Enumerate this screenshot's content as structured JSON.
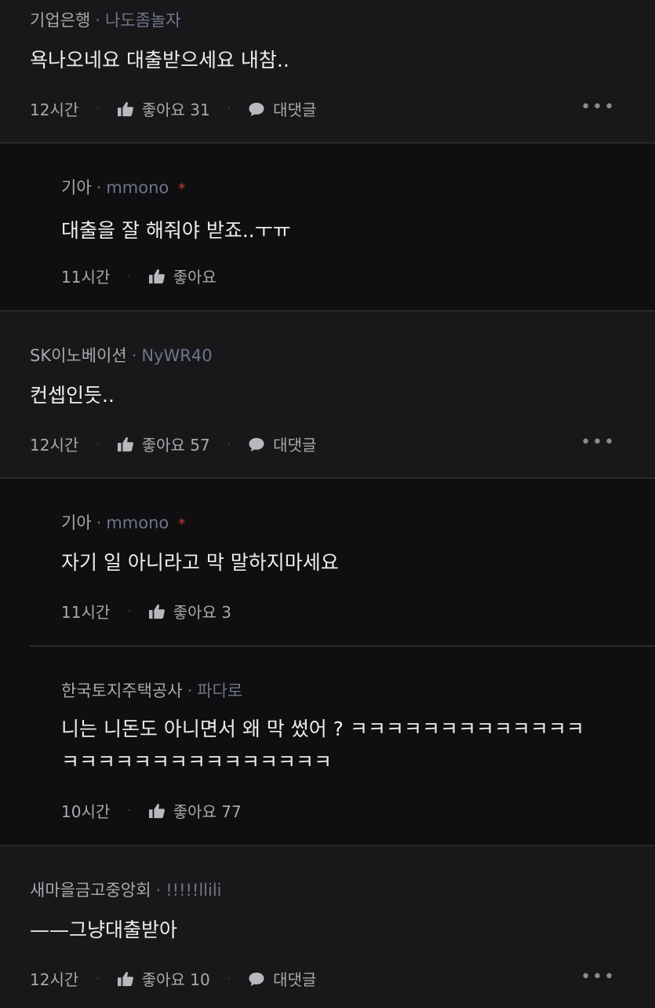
{
  "comments": [
    {
      "company": "기업은행",
      "user": "나도좀놀자",
      "text": "욕나오네요 대출받으세요 내참..",
      "time": "12시간",
      "like_label": "좋아요 31",
      "reply_label": "대댓글"
    },
    {
      "company": "기아",
      "user": "mmono",
      "mark": "*",
      "text": "대출을 잘 해줘야 받죠..ㅜㅠ",
      "time": "11시간",
      "like_label": "좋아요"
    },
    {
      "company": "SK이노베이션",
      "user": "NyWR40",
      "text": "컨셉인듯..",
      "time": "12시간",
      "like_label": "좋아요 57",
      "reply_label": "대댓글"
    },
    {
      "company": "기아",
      "user": "mmono",
      "mark": "*",
      "text": "자기 일 아니라고 막 말하지마세요",
      "time": "11시간",
      "like_label": "좋아요 3"
    },
    {
      "company": "한국토지주택공사",
      "user": "파다로",
      "text_line1": "니는 니돈도 아니면서 왜 막 썼어 ? ㅋㅋㅋㅋㅋㅋㅋㅋㅋㅋㅋㅋㅋ",
      "text_line2": "ㅋㅋㅋㅋㅋㅋㅋㅋㅋㅋㅋㅋㅋㅋㅋ",
      "time": "10시간",
      "like_label": "좋아요 77"
    },
    {
      "company": "새마을금고중앙회",
      "user": "!!!!!llili",
      "text": "——그냥대출받아",
      "time": "12시간",
      "like_label": "좋아요 10",
      "reply_label": "대댓글"
    }
  ],
  "separator_dot": "·",
  "more_label": "•••",
  "icons": [
    "thumbs-up-icon",
    "speech-bubble-icon",
    "more-dots-icon"
  ],
  "colors": {
    "background": "#18181a",
    "reply_background": "#0f0f11",
    "mark": "#d23838",
    "username": "#6f7488"
  }
}
